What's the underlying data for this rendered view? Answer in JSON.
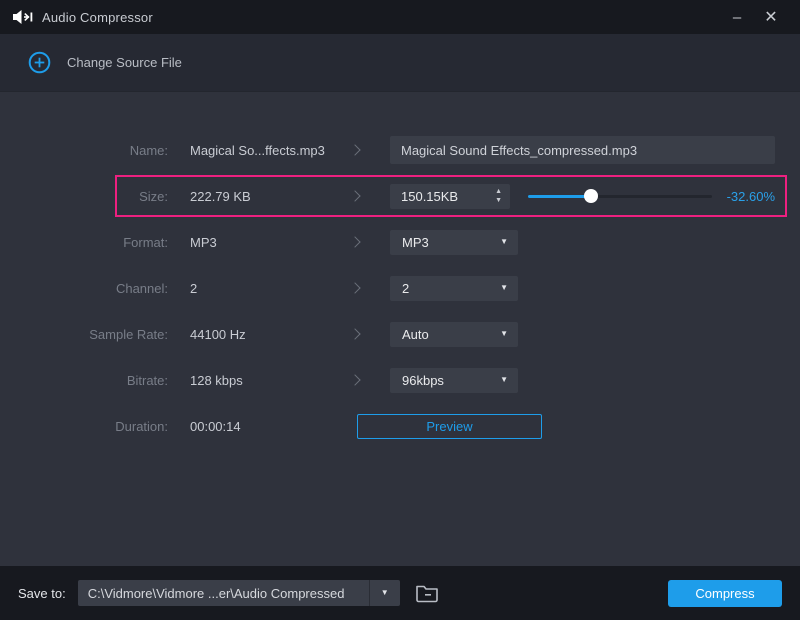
{
  "window": {
    "title": "Audio Compressor",
    "minimize_glyph": "–",
    "close_glyph": "✕"
  },
  "header": {
    "change_source_label": "Change Source File"
  },
  "rows": {
    "name": {
      "label": "Name:",
      "source_value": "Magical So...ffects.mp3",
      "output_value": "Magical Sound Effects_compressed.mp3"
    },
    "size": {
      "label": "Size:",
      "source_value": "222.79 KB",
      "target_value": "150.15KB",
      "reduction_percent": "-32.60%",
      "slider_fill_pct": 34,
      "spin_up_glyph": "▲",
      "spin_down_glyph": "▼"
    },
    "format": {
      "label": "Format:",
      "source_value": "MP3",
      "selected": "MP3"
    },
    "channel": {
      "label": "Channel:",
      "source_value": "2",
      "selected": "2"
    },
    "sample_rate": {
      "label": "Sample Rate:",
      "source_value": "44100 Hz",
      "selected": "Auto"
    },
    "bitrate": {
      "label": "Bitrate:",
      "source_value": "128 kbps",
      "selected": "96kbps"
    },
    "duration": {
      "label": "Duration:",
      "source_value": "00:00:14",
      "preview_label": "Preview"
    }
  },
  "dropdown_arrow_glyph": "▼",
  "footer": {
    "save_to_label": "Save to:",
    "save_path": "C:\\Vidmore\\Vidmore ...er\\Audio Compressed",
    "compress_label": "Compress"
  },
  "colors": {
    "accent_blue": "#1e9dea",
    "highlight_pink": "#ee2080",
    "titlebar_bg": "#17191f",
    "header_bg": "#262933",
    "content_bg": "#2f323c",
    "field_bg": "#3a3e48",
    "percent_text": "#2aa0e8"
  }
}
